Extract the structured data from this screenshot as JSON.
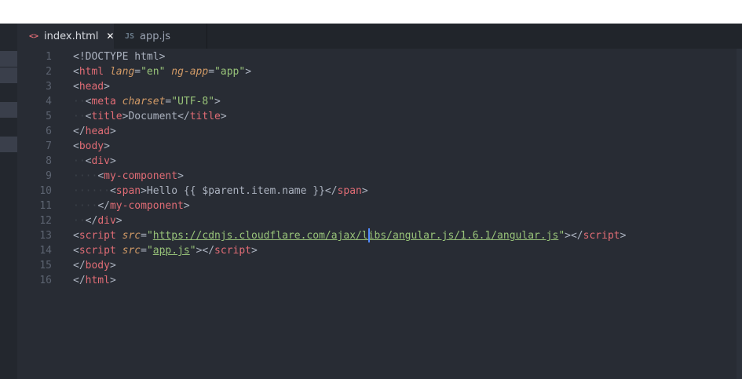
{
  "tabs": [
    {
      "label": "index.html",
      "icon": "html-code-icon",
      "icon_glyph": "<>",
      "active": true,
      "close_glyph": "✕"
    },
    {
      "label": "app.js",
      "icon": "js-file-icon",
      "icon_glyph": "JS",
      "active": false
    }
  ],
  "editor": {
    "lines": [
      {
        "n": "1",
        "tokens": [
          {
            "c": "p",
            "v": "<!DOCTYPE html>"
          }
        ]
      },
      {
        "n": "2",
        "tokens": [
          {
            "c": "p",
            "v": "<"
          },
          {
            "c": "t",
            "v": "html"
          },
          {
            "c": "p",
            "v": " "
          },
          {
            "c": "a",
            "v": "lang"
          },
          {
            "c": "p",
            "v": "="
          },
          {
            "c": "s",
            "v": "\"en\""
          },
          {
            "c": "p",
            "v": " "
          },
          {
            "c": "a",
            "v": "ng-app"
          },
          {
            "c": "p",
            "v": "="
          },
          {
            "c": "s",
            "v": "\"app\""
          },
          {
            "c": "p",
            "v": ">"
          }
        ]
      },
      {
        "n": "3",
        "tokens": [
          {
            "c": "p",
            "v": "<"
          },
          {
            "c": "t",
            "v": "head"
          },
          {
            "c": "p",
            "v": ">"
          }
        ]
      },
      {
        "n": "4",
        "tokens": [
          {
            "c": "ind",
            "v": "··"
          },
          {
            "c": "p",
            "v": "<"
          },
          {
            "c": "t",
            "v": "meta"
          },
          {
            "c": "p",
            "v": " "
          },
          {
            "c": "a",
            "v": "charset"
          },
          {
            "c": "p",
            "v": "="
          },
          {
            "c": "s",
            "v": "\"UTF-8\""
          },
          {
            "c": "p",
            "v": ">"
          }
        ]
      },
      {
        "n": "5",
        "tokens": [
          {
            "c": "ind",
            "v": "··"
          },
          {
            "c": "p",
            "v": "<"
          },
          {
            "c": "t",
            "v": "title"
          },
          {
            "c": "p",
            "v": ">Document</"
          },
          {
            "c": "t",
            "v": "title"
          },
          {
            "c": "p",
            "v": ">"
          }
        ]
      },
      {
        "n": "6",
        "tokens": [
          {
            "c": "p",
            "v": "</"
          },
          {
            "c": "t",
            "v": "head"
          },
          {
            "c": "p",
            "v": ">"
          }
        ]
      },
      {
        "n": "7",
        "tokens": [
          {
            "c": "p",
            "v": "<"
          },
          {
            "c": "t",
            "v": "body"
          },
          {
            "c": "p",
            "v": ">"
          }
        ]
      },
      {
        "n": "8",
        "tokens": [
          {
            "c": "ind",
            "v": "··"
          },
          {
            "c": "p",
            "v": "<"
          },
          {
            "c": "t",
            "v": "div"
          },
          {
            "c": "p",
            "v": ">"
          }
        ]
      },
      {
        "n": "9",
        "tokens": [
          {
            "c": "ind",
            "v": "····"
          },
          {
            "c": "p",
            "v": "<"
          },
          {
            "c": "t",
            "v": "my-component"
          },
          {
            "c": "p",
            "v": ">"
          }
        ]
      },
      {
        "n": "10",
        "tokens": [
          {
            "c": "ind",
            "v": "······"
          },
          {
            "c": "p",
            "v": "<"
          },
          {
            "c": "t",
            "v": "span"
          },
          {
            "c": "p",
            "v": ">Hello {{ $parent.item.name }}</"
          },
          {
            "c": "t",
            "v": "span"
          },
          {
            "c": "p",
            "v": ">"
          }
        ]
      },
      {
        "n": "11",
        "tokens": [
          {
            "c": "ind",
            "v": "····"
          },
          {
            "c": "p",
            "v": "</"
          },
          {
            "c": "t",
            "v": "my-component"
          },
          {
            "c": "p",
            "v": ">"
          }
        ]
      },
      {
        "n": "12",
        "tokens": [
          {
            "c": "ind",
            "v": "··"
          },
          {
            "c": "p",
            "v": "</"
          },
          {
            "c": "t",
            "v": "div"
          },
          {
            "c": "p",
            "v": ">"
          }
        ]
      },
      {
        "n": "13",
        "tokens": [
          {
            "c": "p",
            "v": "<"
          },
          {
            "c": "t",
            "v": "script"
          },
          {
            "c": "p",
            "v": " "
          },
          {
            "c": "a",
            "v": "src"
          },
          {
            "c": "p",
            "v": "="
          },
          {
            "c": "s",
            "v": "\""
          },
          {
            "c": "u",
            "v": "https://cdnjs.cloudflare.com/ajax/libs/angular.js/1.6.1/angular.js"
          },
          {
            "c": "s",
            "v": "\""
          },
          {
            "c": "p",
            "v": "></"
          },
          {
            "c": "t",
            "v": "script"
          },
          {
            "c": "p",
            "v": ">"
          }
        ]
      },
      {
        "n": "14",
        "tokens": [
          {
            "c": "p",
            "v": "<"
          },
          {
            "c": "t",
            "v": "script"
          },
          {
            "c": "p",
            "v": " "
          },
          {
            "c": "a",
            "v": "src"
          },
          {
            "c": "p",
            "v": "="
          },
          {
            "c": "s",
            "v": "\""
          },
          {
            "c": "u",
            "v": "app.js"
          },
          {
            "c": "s",
            "v": "\""
          },
          {
            "c": "p",
            "v": "></"
          },
          {
            "c": "t",
            "v": "script"
          },
          {
            "c": "p",
            "v": ">"
          }
        ]
      },
      {
        "n": "15",
        "tokens": [
          {
            "c": "p",
            "v": "</"
          },
          {
            "c": "t",
            "v": "body"
          },
          {
            "c": "p",
            "v": ">"
          }
        ]
      },
      {
        "n": "16",
        "tokens": [
          {
            "c": "p",
            "v": "</"
          },
          {
            "c": "t",
            "v": "html"
          },
          {
            "c": "p",
            "v": ">"
          }
        ]
      }
    ],
    "cursor": {
      "line": "13",
      "column": "48"
    }
  },
  "colors": {
    "editor_bg": "#282c34",
    "tabbar_bg": "#21252b",
    "tag": "#e06c75",
    "attribute": "#d19a66",
    "string": "#98c379",
    "plain": "#abb2bf",
    "line_number": "#5c6370",
    "cursor": "#528bff"
  }
}
